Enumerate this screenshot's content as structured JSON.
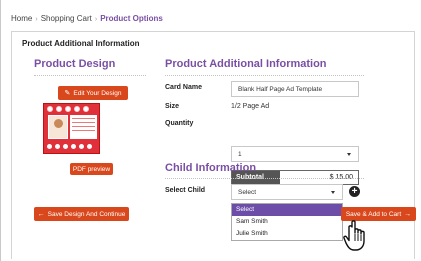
{
  "breadcrumb": {
    "items": [
      "Home",
      "Shopping Cart",
      "Product Options"
    ],
    "separator": "›"
  },
  "panel": {
    "title": "Product Additional Information"
  },
  "design": {
    "heading": "Product Design",
    "edit_button": "Edit Your Design",
    "edit_icon": "edit-icon",
    "preview_button": "PDF preview",
    "save_continue_button": "Save Design And Continue",
    "save_continue_icon": "arrow-left-icon"
  },
  "info": {
    "heading": "Product Additional Information",
    "card_name_label": "Card Name",
    "card_name_value": "Blank Half Page Ad Template",
    "size_label": "Size",
    "size_value": "1/2 Page Ad",
    "quantity_label": "Quantity",
    "quantity_value": "1",
    "subtotal_label": "Subtotal",
    "subtotal_value": "$ 15.00"
  },
  "child": {
    "heading": "Child Information",
    "select_label": "Select Child",
    "select_value": "Select",
    "options": [
      "Select",
      "Sam Smith",
      "Julie Smith"
    ],
    "add_icon": "plus-icon"
  },
  "cart": {
    "save_add_button": "Save & Add to Cart",
    "save_add_icon": "arrow-right-icon"
  },
  "colors": {
    "accent_purple": "#7a4fa3",
    "button_orange": "#d9481d",
    "dropdown_highlight": "#6c4ea8"
  }
}
